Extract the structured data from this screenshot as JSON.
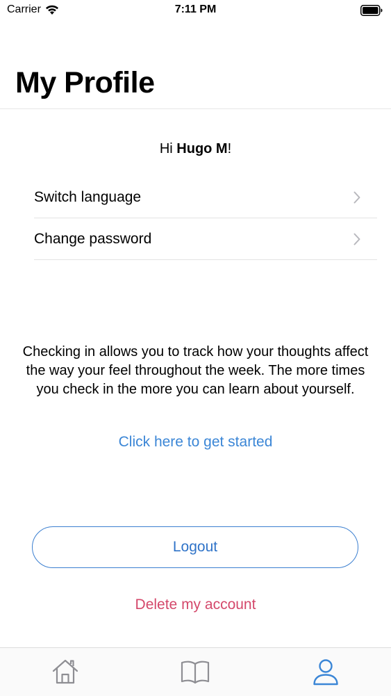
{
  "status_bar": {
    "carrier": "Carrier",
    "time": "7:11 PM"
  },
  "header": {
    "title": "My Profile"
  },
  "greeting": {
    "prefix": "Hi ",
    "name": "Hugo M",
    "suffix": "!"
  },
  "menu": {
    "items": [
      {
        "label": "Switch language",
        "icon": "chevron-right-icon"
      },
      {
        "label": "Change password",
        "icon": "chevron-right-icon"
      }
    ]
  },
  "info": {
    "text": "Checking in allows you to track how your thoughts affect the way your feel throughout the week. The more times you check in the more you can learn about yourself.",
    "link": "Click here to get started"
  },
  "actions": {
    "logout": "Logout",
    "delete": "Delete my account"
  },
  "tab_bar": {
    "tabs": [
      {
        "icon": "home-icon",
        "active": false
      },
      {
        "icon": "book-icon",
        "active": false
      },
      {
        "icon": "person-icon",
        "active": true
      }
    ]
  },
  "colors": {
    "accent": "#3b86d6",
    "destructive": "#d4486b",
    "inactive_icon": "#8e8e93"
  }
}
